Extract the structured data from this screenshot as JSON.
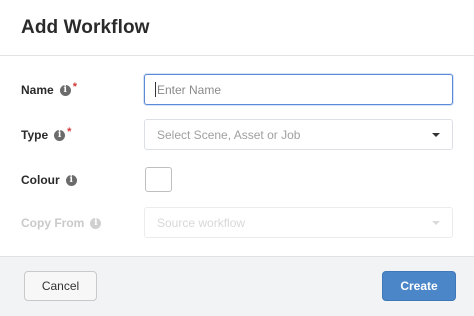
{
  "dialog": {
    "title": "Add Workflow"
  },
  "form": {
    "name": {
      "label": "Name",
      "required_mark": "*",
      "placeholder": "Enter Name",
      "value": ""
    },
    "type": {
      "label": "Type",
      "required_mark": "*",
      "placeholder": "Select Scene, Asset or Job"
    },
    "colour": {
      "label": "Colour",
      "value": "#ffffff"
    },
    "copy_from": {
      "label": "Copy From",
      "placeholder": "Source workflow",
      "disabled": true
    }
  },
  "icons": {
    "info": "info-icon",
    "dropdown": "chevron-down-icon"
  },
  "footer": {
    "cancel_label": "Cancel",
    "create_label": "Create"
  },
  "colors": {
    "primary": "#4a86c8",
    "required": "#d23a3a",
    "focus_border": "#5b8ad6"
  }
}
